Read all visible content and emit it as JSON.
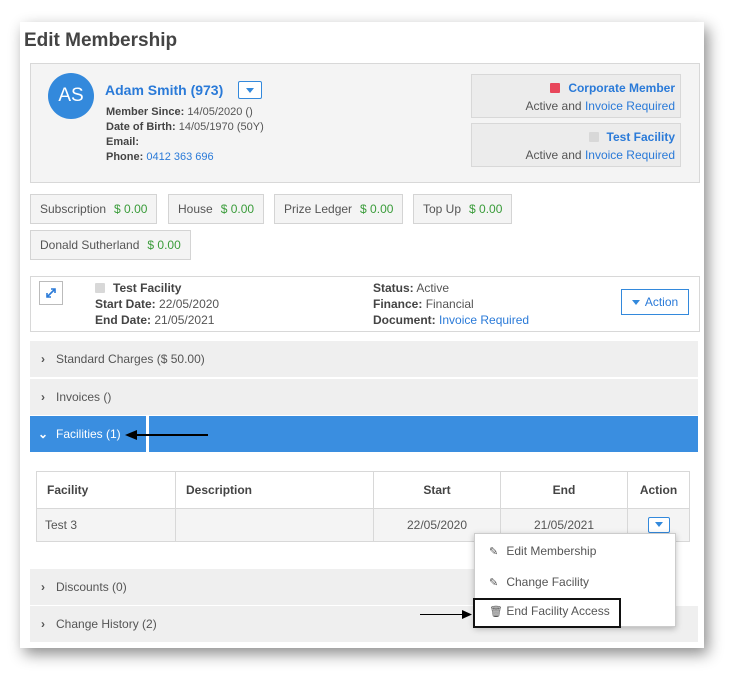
{
  "page_title": "Edit Membership",
  "member": {
    "initials": "AS",
    "name": "Adam Smith (973)",
    "member_since_label": "Member Since:",
    "member_since": "14/05/2020 ()",
    "dob_label": "Date of Birth:",
    "dob": "14/05/1970 (50Y)",
    "email_label": "Email:",
    "email": "",
    "phone_label": "Phone:",
    "phone": "0412 363 696"
  },
  "memberships": [
    {
      "title": "Corporate Member",
      "status": "Active and",
      "link": "Invoice Required",
      "color": "#e8475b"
    },
    {
      "title": "Test Facility",
      "status": "Active and",
      "link": "Invoice Required",
      "color": "#d8d8d8"
    }
  ],
  "ledgers": [
    {
      "label": "Subscription",
      "amount": "$ 0.00"
    },
    {
      "label": "House",
      "amount": "$ 0.00"
    },
    {
      "label": "Prize Ledger",
      "amount": "$ 0.00"
    },
    {
      "label": "Top Up",
      "amount": "$ 0.00"
    },
    {
      "label": "Donald Sutherland",
      "amount": "$ 0.00"
    }
  ],
  "facility": {
    "name": "Test Facility",
    "start_label": "Start Date:",
    "start": "22/05/2020",
    "end_label": "End Date:",
    "end": "21/05/2021",
    "status_label": "Status:",
    "status": "Active",
    "finance_label": "Finance:",
    "finance": "Financial",
    "document_label": "Document:",
    "document": "Invoice Required",
    "action_label": "Action"
  },
  "sections": {
    "standard_charges": "Standard Charges ($ 50.00)",
    "invoices": "Invoices ()",
    "facilities": "Facilities (1)",
    "discounts": "Discounts (0)",
    "change_history": "Change History (2)"
  },
  "table": {
    "headers": [
      "Facility",
      "Description",
      "Start",
      "End",
      "Action"
    ],
    "rows": [
      {
        "facility": "Test 3",
        "description": "",
        "start": "22/05/2020",
        "end": "21/05/2021"
      }
    ]
  },
  "menu": {
    "edit_membership": "Edit Membership",
    "change_facility": "Change Facility",
    "end_facility_access": "End Facility Access"
  },
  "colors": {
    "accent": "#3389dc",
    "open_section": "#3a8ee0",
    "amount": "#3a9c3a"
  }
}
